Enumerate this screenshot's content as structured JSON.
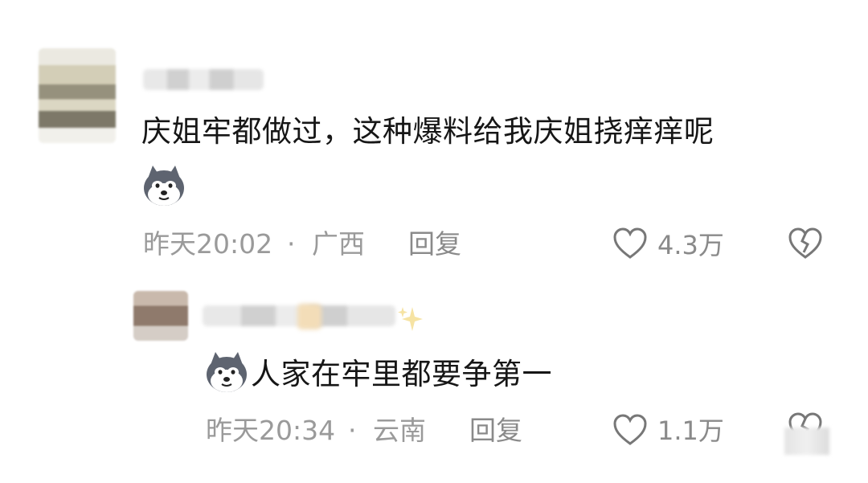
{
  "comment1": {
    "text": "庆姐牢都做过，这种爆料给我庆姐挠痒痒呢",
    "time": "昨天20:02",
    "sep": "·",
    "location": "广西",
    "reply_label": "回复",
    "likes": "4.3万",
    "emoji_icon": "husky-dog-emoji-icon"
  },
  "comment2": {
    "text": "人家在牢里都要争第一",
    "time": "昨天20:34",
    "sep": "·",
    "location": "云南",
    "reply_label": "回复",
    "likes": "1.1万",
    "name_decoration_icon": "sparkle-icon",
    "emoji_icon": "husky-dog-emoji-icon"
  },
  "colors": {
    "text": "#161616",
    "meta": "#9a9a9a",
    "icon_stroke": "#777777"
  }
}
